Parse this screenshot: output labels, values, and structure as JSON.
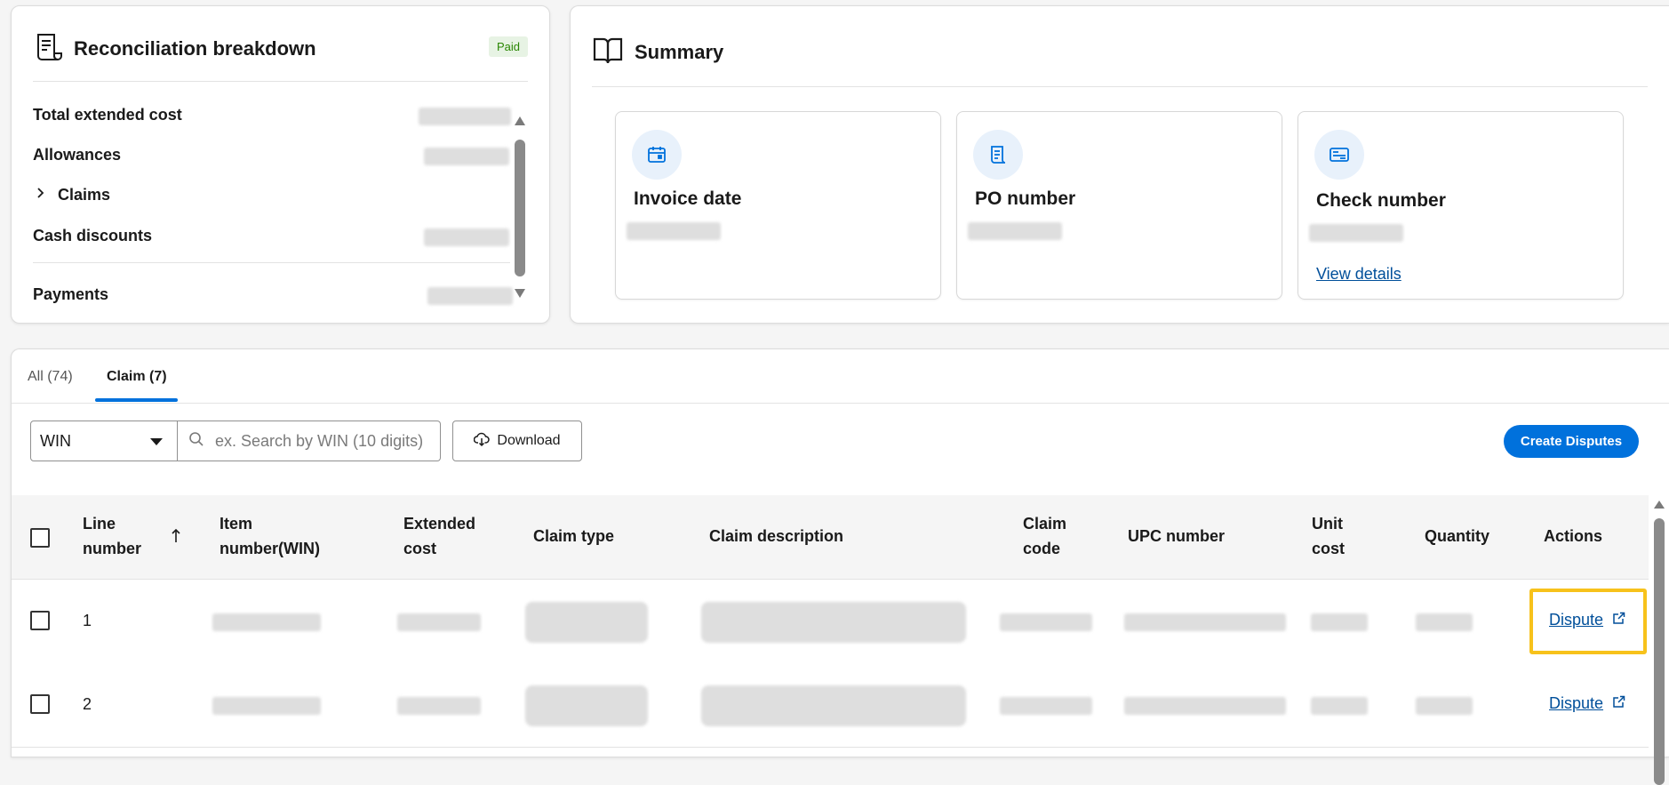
{
  "reconciliation": {
    "title": "Reconciliation breakdown",
    "status_badge": "Paid",
    "rows": [
      {
        "label": "Total extended cost"
      },
      {
        "label": "Allowances"
      },
      {
        "label": "Claims"
      },
      {
        "label": "Cash discounts"
      },
      {
        "label": "Payments"
      }
    ]
  },
  "summary": {
    "title": "Summary",
    "cards": [
      {
        "label": "Invoice date",
        "icon": "calendar-icon"
      },
      {
        "label": "PO number",
        "icon": "document-icon"
      },
      {
        "label": "Check number",
        "icon": "check-icon",
        "link": "View details"
      }
    ]
  },
  "tabs": [
    {
      "label": "All (74)"
    },
    {
      "label": "Claim (7)",
      "active": true
    }
  ],
  "toolbar": {
    "select_value": "WIN",
    "search_placeholder": "ex. Search by WIN (10 digits)",
    "download_label": "Download",
    "create_label": "Create Disputes"
  },
  "table": {
    "columns": [
      {
        "line1": "Line",
        "line2": "number"
      },
      {
        "line1": "Item",
        "line2": "number(WIN)"
      },
      {
        "line1": "Extended",
        "line2": "cost"
      },
      {
        "line1": "Claim type",
        "line2": ""
      },
      {
        "line1": "Claim description",
        "line2": ""
      },
      {
        "line1": "Claim",
        "line2": "code"
      },
      {
        "line1": "UPC number",
        "line2": ""
      },
      {
        "line1": "Unit",
        "line2": "cost"
      },
      {
        "line1": "Quantity",
        "line2": ""
      },
      {
        "line1": "Actions",
        "line2": ""
      }
    ],
    "rows": [
      {
        "line_number": "1",
        "action": "Dispute"
      },
      {
        "line_number": "2",
        "action": "Dispute"
      }
    ]
  },
  "colors": {
    "accent": "#0071dc",
    "link": "#004f9a",
    "badge_bg": "#e7f3e4",
    "badge_text": "#2a8703",
    "highlight": "#f7c21b"
  }
}
